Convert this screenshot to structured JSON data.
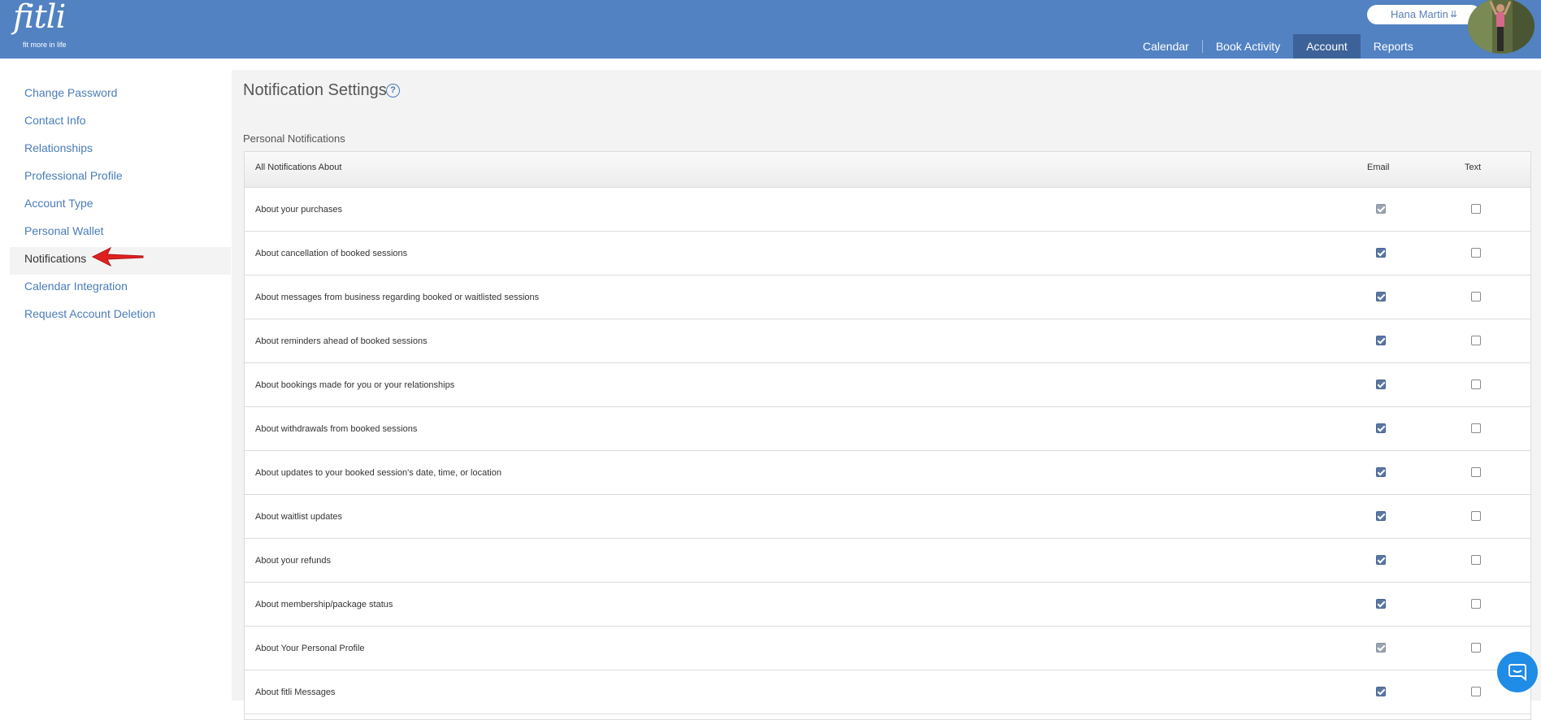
{
  "header": {
    "logo_text": "fitli",
    "logo_tagline": "fit more in life",
    "user_name": "Hana Martin",
    "nav": [
      {
        "label": "Calendar",
        "active": false
      },
      {
        "label": "Book Activity",
        "active": false
      },
      {
        "label": "Account",
        "active": true
      },
      {
        "label": "Reports",
        "active": false
      }
    ],
    "colors": {
      "bar": "#5282c2",
      "active_tab": "#3d6299"
    }
  },
  "sidebar": {
    "items": [
      {
        "label": "Change Password",
        "active": false
      },
      {
        "label": "Contact Info",
        "active": false
      },
      {
        "label": "Relationships",
        "active": false
      },
      {
        "label": "Professional Profile",
        "active": false
      },
      {
        "label": "Account Type",
        "active": false
      },
      {
        "label": "Personal Wallet",
        "active": false
      },
      {
        "label": "Notifications",
        "active": true
      },
      {
        "label": "Calendar Integration",
        "active": false
      },
      {
        "label": "Request Account Deletion",
        "active": false
      }
    ]
  },
  "main": {
    "title": "Notification Settings",
    "help_icon": "question-circle-icon",
    "section_title": "Personal Notifications",
    "table": {
      "headers": {
        "label": "All Notifications About",
        "email": "Email",
        "text": "Text"
      },
      "rows": [
        {
          "label": "About your purchases",
          "email": true,
          "email_disabled": true,
          "text": false
        },
        {
          "label": "About cancellation of booked sessions",
          "email": true,
          "email_disabled": false,
          "text": false
        },
        {
          "label": "About messages from business regarding booked or waitlisted sessions",
          "email": true,
          "email_disabled": false,
          "text": false
        },
        {
          "label": "About reminders ahead of booked sessions",
          "email": true,
          "email_disabled": false,
          "text": false
        },
        {
          "label": "About bookings made for you or your relationships",
          "email": true,
          "email_disabled": false,
          "text": false
        },
        {
          "label": "About withdrawals from booked sessions",
          "email": true,
          "email_disabled": false,
          "text": false
        },
        {
          "label": "About updates to your booked session's date, time, or location",
          "email": true,
          "email_disabled": false,
          "text": false
        },
        {
          "label": "About waitlist updates",
          "email": true,
          "email_disabled": false,
          "text": false
        },
        {
          "label": "About your refunds",
          "email": true,
          "email_disabled": false,
          "text": false
        },
        {
          "label": "About membership/package status",
          "email": true,
          "email_disabled": false,
          "text": false
        },
        {
          "label": "About Your Personal Profile",
          "email": true,
          "email_disabled": true,
          "text": false
        },
        {
          "label": "About fitli Messages",
          "email": true,
          "email_disabled": false,
          "text": false
        }
      ]
    }
  },
  "chat": {
    "icon": "chat-bubble-icon",
    "color": "#1f8ce6"
  }
}
